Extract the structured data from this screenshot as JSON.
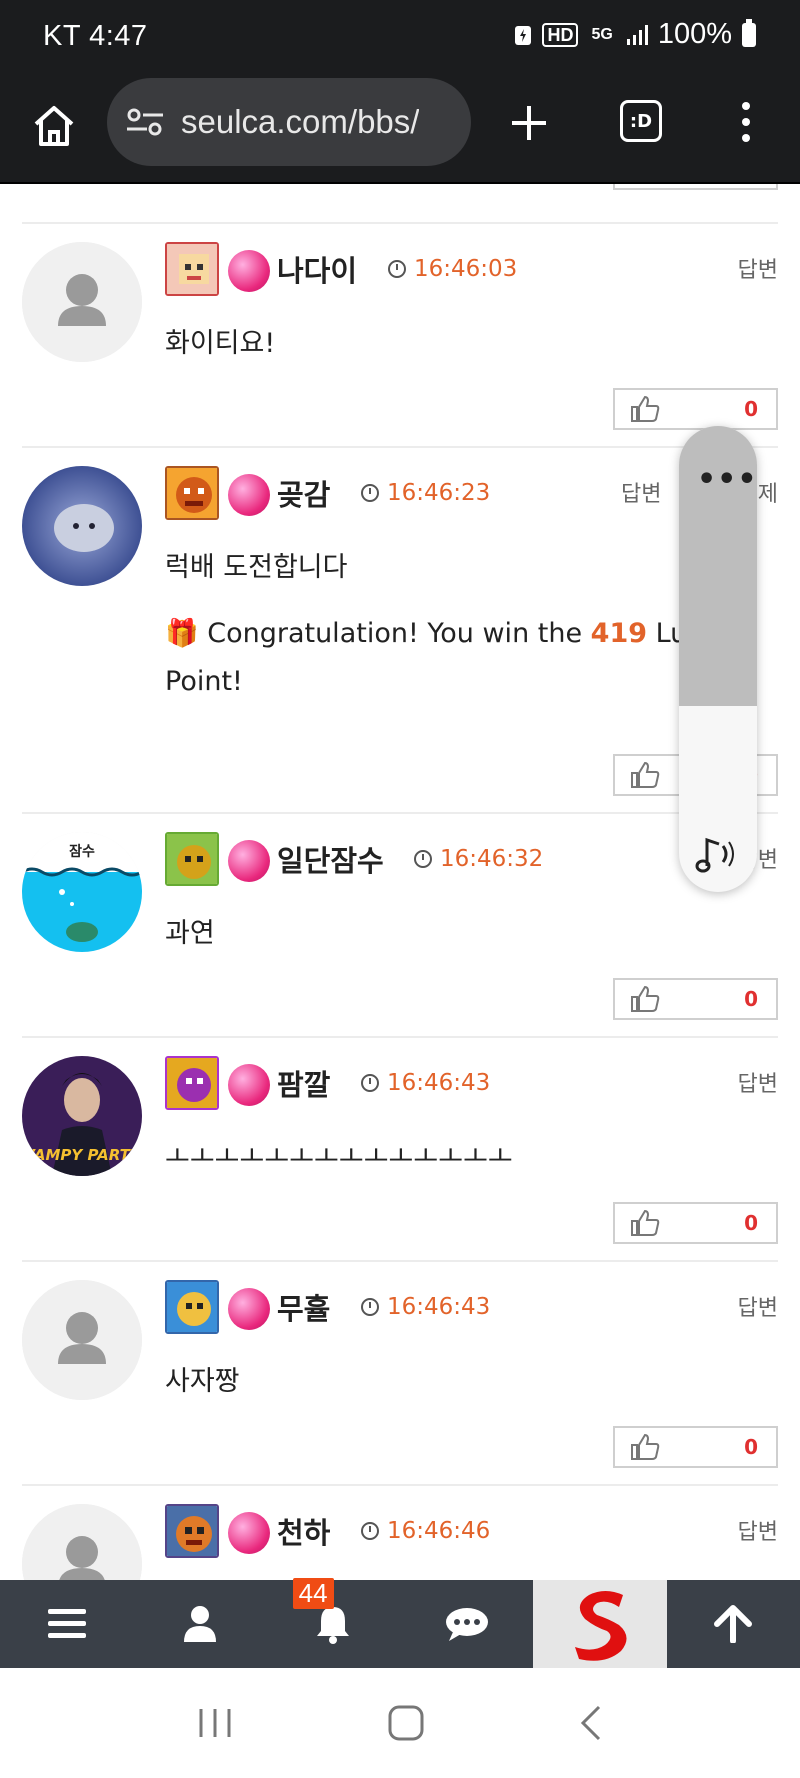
{
  "status": {
    "carrier_time": "KT 4:47",
    "battery": "100%",
    "icons": [
      "battery-saver-icon",
      "hd-icon",
      "5g-icon",
      "signal-icon"
    ],
    "hd_label": "HD",
    "fiveg_label": "5G"
  },
  "browser": {
    "url": "seulca.com/bbs/",
    "tabs_label": ":D"
  },
  "comments": [
    {
      "nick": "나다이",
      "time": "16:46:03",
      "reply": "답변",
      "text": "화이티요!",
      "likes": "0"
    },
    {
      "nick": "곶감",
      "time": "16:46:23",
      "reply": "답변",
      "delete": "삭제",
      "text": "럭배 도전합니다",
      "prize_pre": "Congratulation! You win the ",
      "prize_amount": "419",
      "prize_post": " Lucky Point!",
      "likes": "0"
    },
    {
      "nick": "일단잠수",
      "time": "16:46:32",
      "reply": "답변",
      "text": "과연",
      "likes": "0",
      "avatar_text": "잠수"
    },
    {
      "nick": "팜깔",
      "time": "16:46:43",
      "reply": "답변",
      "text": "ㅗㅗㅗㅗㅗㅗㅗㅗㅗㅗㅗㅗㅗㅗ",
      "likes": "0",
      "avatar_text": "VAMPY PARTY"
    },
    {
      "nick": "무휼",
      "time": "16:46:43",
      "reply": "답변",
      "text": "사자짱",
      "likes": "0"
    },
    {
      "nick": "천하",
      "time": "16:46:46",
      "reply": "답변"
    }
  ],
  "float_panel": {
    "icons": [
      "more-icon",
      "music-icon"
    ]
  },
  "bottom_nav": {
    "notification_count": "44",
    "icons": [
      "menu-icon",
      "user-icon",
      "bell-icon",
      "chat-icon",
      "site-logo",
      "arrow-up-icon"
    ]
  },
  "colors": {
    "time": "#e2632a",
    "likes": "#e03030",
    "nav_bg": "#3a4048",
    "badge": "#f04c14"
  }
}
